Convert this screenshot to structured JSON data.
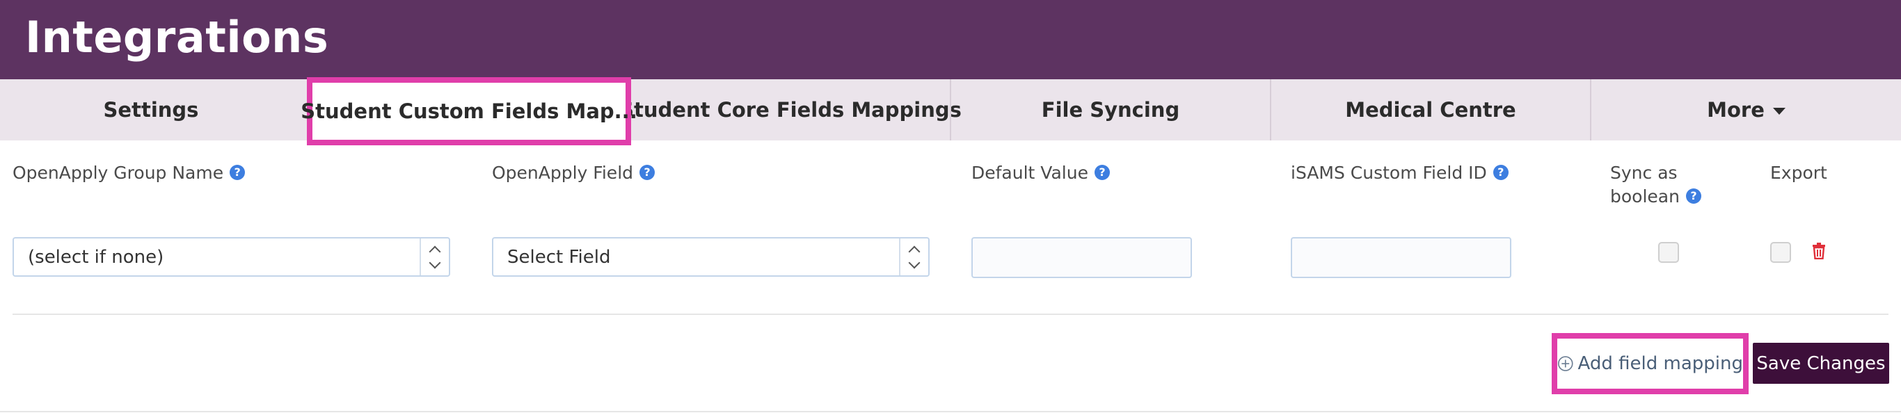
{
  "header": {
    "title": "Integrations"
  },
  "tabs": [
    {
      "label": "Settings"
    },
    {
      "label": "Student Custom Fields Map..."
    },
    {
      "label": "Student Core Fields Mappings"
    },
    {
      "label": "File Syncing"
    },
    {
      "label": "Medical Centre"
    },
    {
      "label": "More"
    }
  ],
  "columns": {
    "group_name": "OpenApply Group Name",
    "field": "OpenApply Field",
    "default_value": "Default Value",
    "custom_field_id": "iSAMS Custom Field ID",
    "sync_boolean_line1": "Sync as",
    "sync_boolean_line2": "boolean",
    "export": "Export"
  },
  "help_glyph": "?",
  "mapping_row": {
    "group_select": "(select if none)",
    "field_select": "Select Field",
    "default_value": "",
    "custom_field_id": "",
    "sync_as_boolean": false,
    "export": false
  },
  "actions": {
    "add_mapping": "Add field mapping",
    "save": "Save Changes"
  },
  "colors": {
    "header_bg": "#5d3361",
    "tabbar_bg": "#ebe4eb",
    "highlight": "#e03eaa",
    "help_icon": "#3d7ee0",
    "save_bg": "#3d0f3a",
    "delete_icon": "#e0303a"
  },
  "icons": {
    "help": "question-circle-icon",
    "caret": "caret-down-icon",
    "delete": "trash-icon",
    "add": "plus-circle-icon"
  }
}
